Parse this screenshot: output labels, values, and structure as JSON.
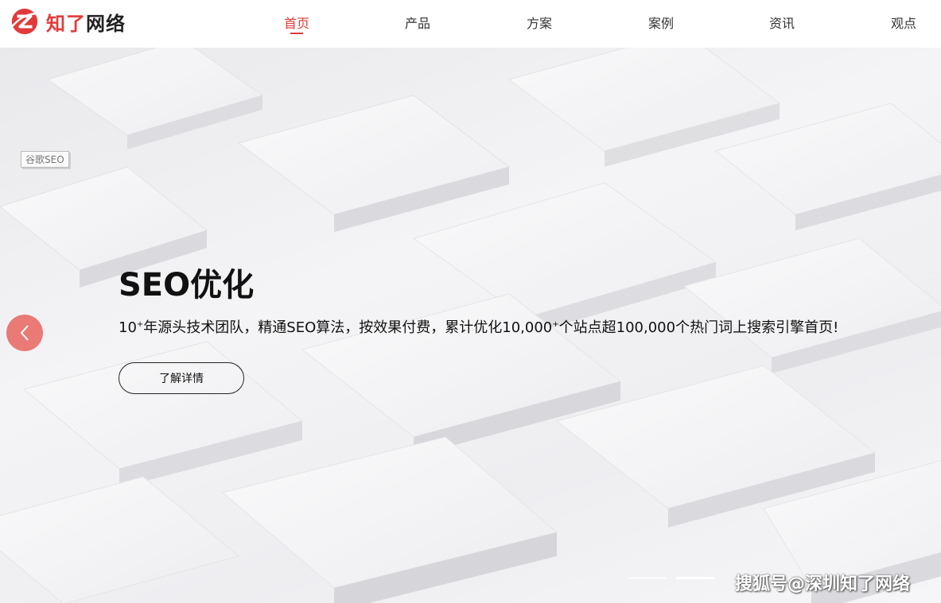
{
  "brand": {
    "logo_text_red": "知了",
    "logo_text_dark": "网络",
    "accent_color": "#e23a3a"
  },
  "nav": {
    "items": [
      {
        "label": "首页",
        "active": true
      },
      {
        "label": "产品",
        "active": false
      },
      {
        "label": "方案",
        "active": false
      },
      {
        "label": "案例",
        "active": false
      },
      {
        "label": "资讯",
        "active": false
      },
      {
        "label": "观点",
        "active": false
      }
    ]
  },
  "hero": {
    "tag": "谷歌SEO",
    "title": "SEO优化",
    "desc_part1": "10",
    "desc_sup1": "+",
    "desc_part2": "年源头技术团队，精通SEO算法，按效果付费，累计优化10,000",
    "desc_sup2": "+",
    "desc_part3": "个站点超100,000个热门词上搜索引擎首页!",
    "button_label": "了解详情",
    "prev_icon": "chevron-left-icon",
    "slides_count": 2,
    "active_slide": 1
  },
  "watermark": "搜狐号@深圳知了网络"
}
